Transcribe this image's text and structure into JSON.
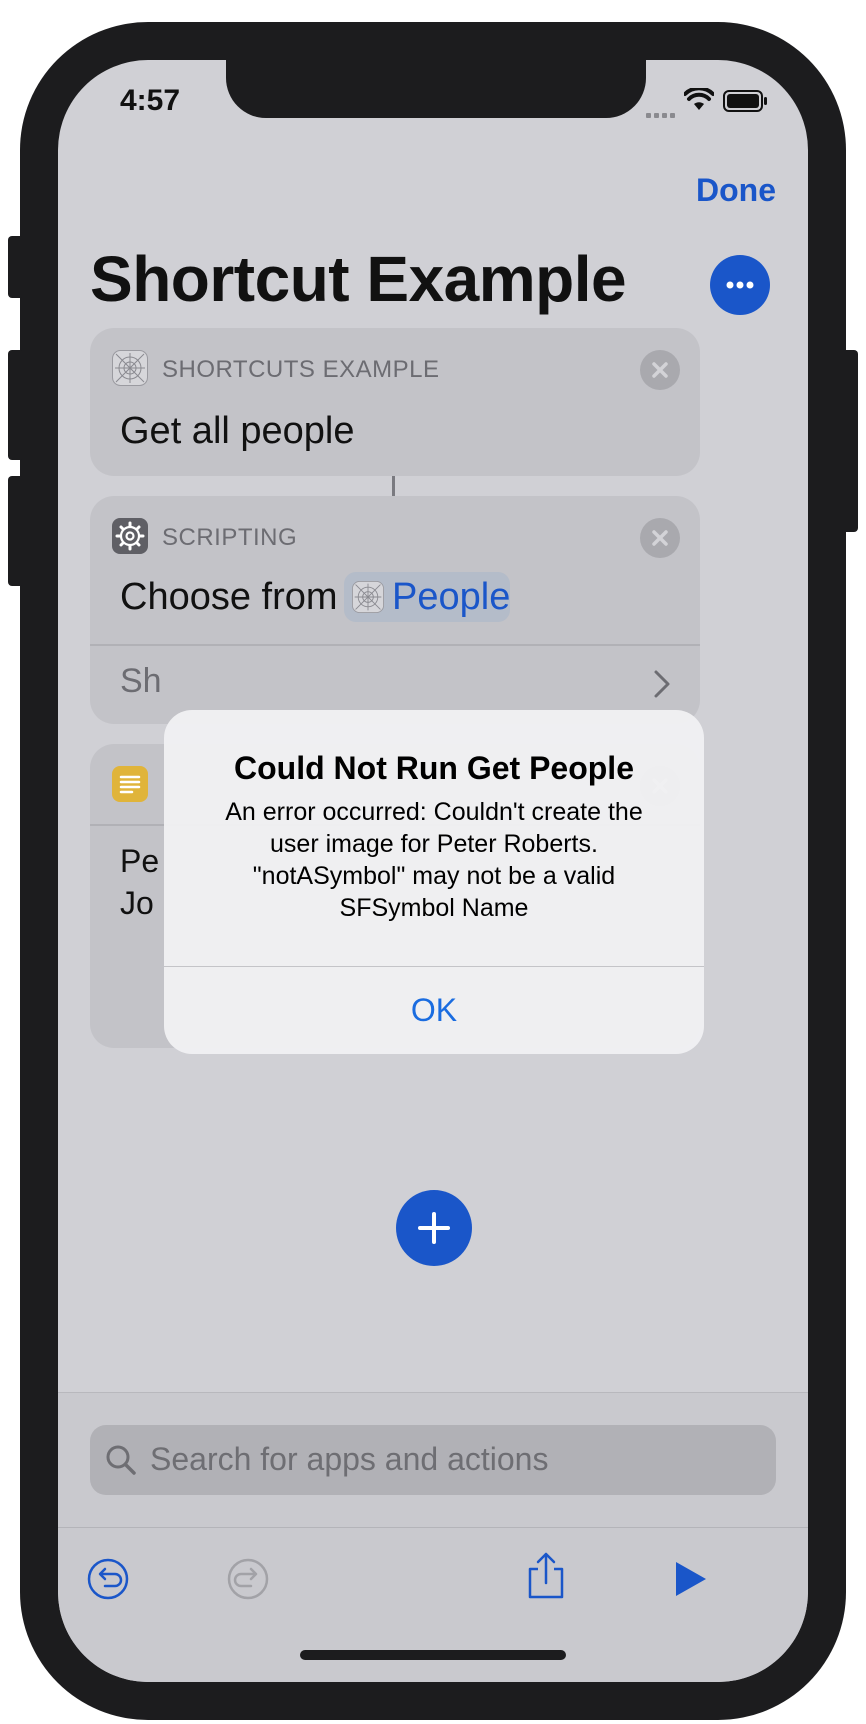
{
  "status_bar": {
    "time": "4:57"
  },
  "nav": {
    "done_label": "Done"
  },
  "page": {
    "title": "Shortcut Example"
  },
  "cards": [
    {
      "app": "SHORTCUTS EXAMPLE",
      "action": "Get all people"
    },
    {
      "app": "SCRIPTING",
      "action_prefix": "Choose from",
      "variable": "People",
      "footer": "Sh"
    },
    {
      "line1": "Pe",
      "line2": "Jo"
    }
  ],
  "search": {
    "placeholder": "Search for apps and actions"
  },
  "alert": {
    "title": "Could Not Run Get People",
    "message": "An error occurred: Couldn't create the user image for Peter Roberts. \"notASymbol\" may not be a valid SFSymbol Name",
    "ok_label": "OK"
  },
  "icons": [
    "wifi-icon",
    "battery-icon",
    "more-icon",
    "close-icon",
    "chevron-right-icon",
    "gear-icon",
    "text-icon",
    "plus-icon",
    "search-icon",
    "undo-icon",
    "redo-icon",
    "share-icon",
    "play-icon"
  ],
  "colors": {
    "accent": "#1a56c9",
    "alert_button": "#1a6ce0",
    "text_icon": "#e8b52b"
  }
}
